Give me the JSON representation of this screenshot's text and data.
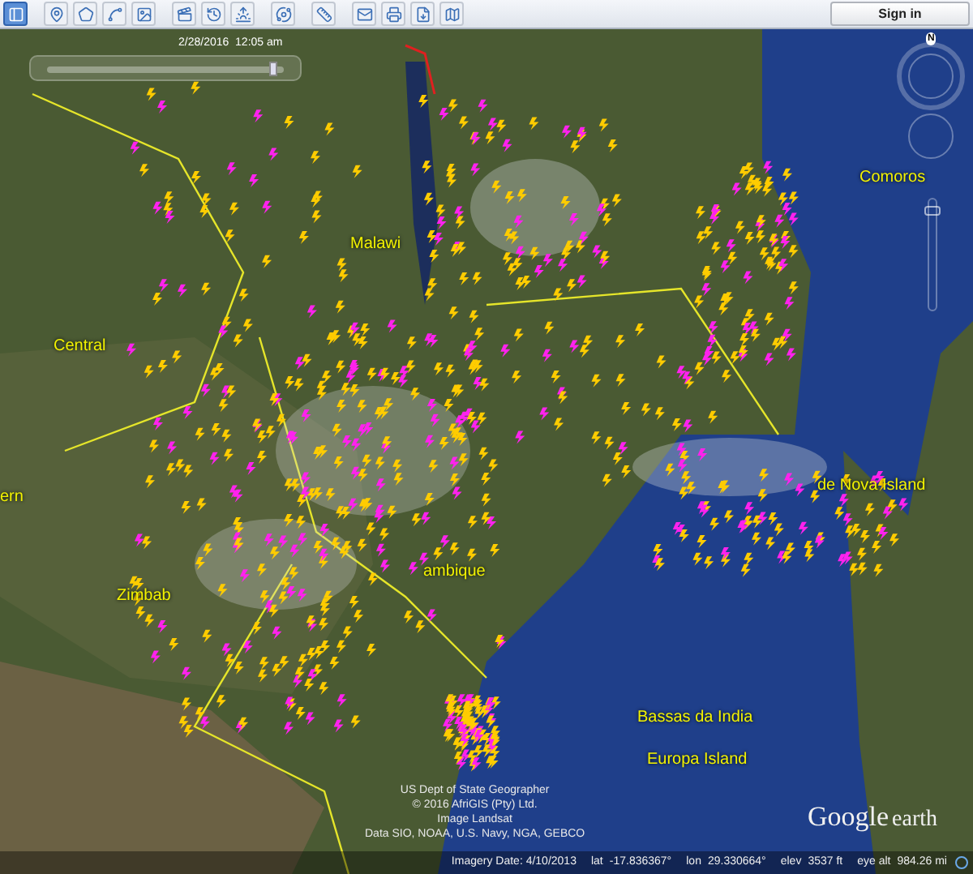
{
  "toolbar": {
    "buttons": [
      {
        "kind": "sidebar",
        "selected": true
      },
      {
        "kind": "placemark",
        "selected": false
      },
      {
        "kind": "polygon",
        "selected": false
      },
      {
        "kind": "path",
        "selected": false
      },
      {
        "kind": "overlay",
        "selected": false
      },
      {
        "kind": "tour",
        "selected": false
      },
      {
        "kind": "history",
        "selected": false
      },
      {
        "kind": "sunlight",
        "selected": false
      },
      {
        "kind": "planets",
        "selected": false
      },
      {
        "kind": "ruler",
        "selected": false
      },
      {
        "kind": "email",
        "selected": false
      },
      {
        "kind": "print",
        "selected": false
      },
      {
        "kind": "save",
        "selected": false
      },
      {
        "kind": "maps",
        "selected": false
      }
    ],
    "sign_in": "Sign in"
  },
  "time_slider": {
    "date": "2/28/2016  12:05 am",
    "level": 0.96
  },
  "compass": {
    "north": "N"
  },
  "zoom_slider": {
    "level": 0.9
  },
  "map_labels": [
    {
      "text": "Malawi"
    },
    {
      "text": "Central"
    },
    {
      "text": "ern"
    },
    {
      "text": "ambique"
    },
    {
      "text": "Zimbab"
    },
    {
      "text": "Comoros"
    },
    {
      "text": "de Nova Island"
    },
    {
      "text": "Bassas da India"
    },
    {
      "text": "Europa Island"
    }
  ],
  "attribution": [
    "US Dept of State Geographer",
    "© 2016 AfriGIS (Pty) Ltd.",
    "Image Landsat",
    "Data SIO, NOAA, U.S. Navy, NGA, GEBCO"
  ],
  "logo": {
    "google": "Google",
    "earth": "earth"
  },
  "status_bar": [
    {
      "label": "Imagery Date: 4/10/2013"
    },
    {
      "label": "lat",
      "value": "-17.836367°"
    },
    {
      "label": "lon",
      "value": "29.330664°"
    },
    {
      "label": "elev",
      "value": "3537 ft"
    },
    {
      "label": "eye alt",
      "value": "984.26 mi"
    }
  ]
}
